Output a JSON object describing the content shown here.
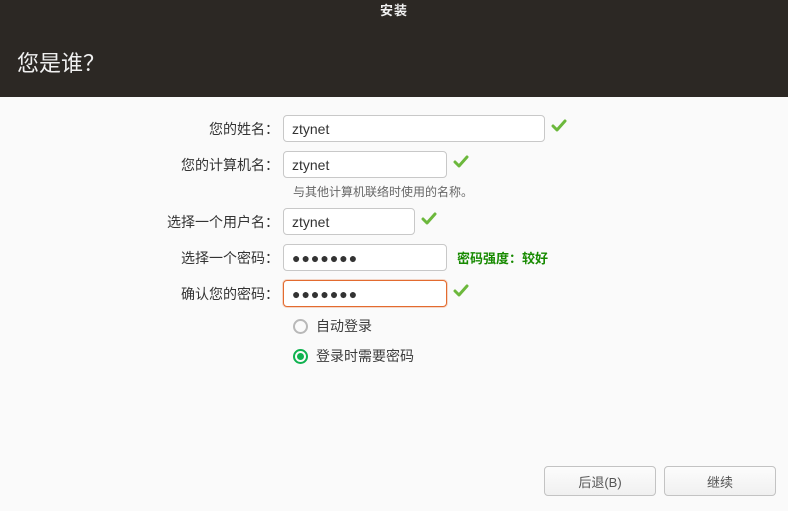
{
  "header": {
    "app_title": "安装",
    "page_title": "您是谁？"
  },
  "form": {
    "name": {
      "label": "您的姓名：",
      "value": "ztynet"
    },
    "host": {
      "label": "您的计算机名：",
      "value": "ztynet",
      "hint": "与其他计算机联络时使用的名称。"
    },
    "user": {
      "label": "选择一个用户名：",
      "value": "ztynet"
    },
    "pass": {
      "label": "选择一个密码：",
      "value": "●●●●●●●",
      "strength": "密码强度：较好"
    },
    "confirm": {
      "label": "确认您的密码：",
      "value": "●●●●●●●"
    },
    "radios": {
      "auto_login": {
        "label": "自动登录",
        "selected": false
      },
      "require_pass": {
        "label": "登录时需要密码",
        "selected": true
      }
    }
  },
  "footer": {
    "back": "后退(B)",
    "continue": "继续"
  }
}
